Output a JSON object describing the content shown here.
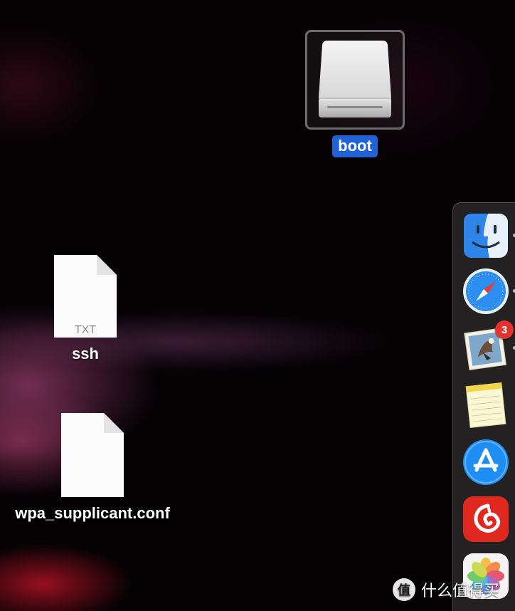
{
  "desktop": {
    "items": [
      {
        "label": "boot",
        "kind": "external-drive",
        "selected": true
      },
      {
        "label": "ssh",
        "kind": "text-file",
        "file_type": "TXT"
      },
      {
        "label": "wpa_supplicant.conf",
        "kind": "document-file"
      }
    ]
  },
  "dock": {
    "apps": [
      {
        "name": "Finder",
        "icon": "finder-icon",
        "running": true
      },
      {
        "name": "Safari",
        "icon": "safari-icon",
        "running": true
      },
      {
        "name": "Mail",
        "icon": "mail-icon",
        "running": true,
        "badge": "3"
      },
      {
        "name": "Notes",
        "icon": "notes-icon",
        "running": false
      },
      {
        "name": "App Store",
        "icon": "app-store-icon",
        "running": false
      },
      {
        "name": "NetEase Cloud Music",
        "icon": "netease-music-icon",
        "running": false
      },
      {
        "name": "Photos",
        "icon": "photos-icon",
        "running": false
      }
    ]
  },
  "watermark": {
    "logo_char": "值",
    "text": "什么值得买"
  },
  "colors": {
    "selection": "#2162d6",
    "badge": "#e2332f",
    "netease_red": "#e0281e"
  }
}
